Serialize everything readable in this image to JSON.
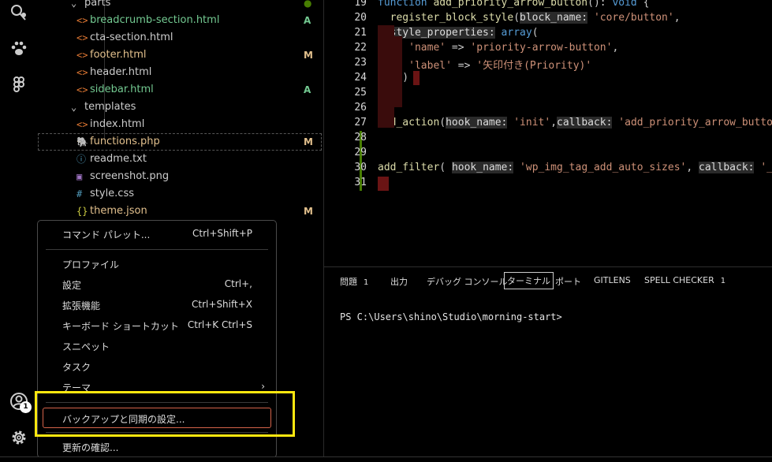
{
  "activity_bar": {
    "icons": [
      "search-fuzzy-icon",
      "paw-icon",
      "figma-icon",
      "account-icon",
      "settings-gear-icon"
    ],
    "account_badge": "1"
  },
  "explorer": {
    "items": [
      {
        "name": "parts",
        "type": "folder",
        "git": "●",
        "color": "#cccccc",
        "git_color": "#487e02"
      },
      {
        "name": "breadcrumb-section.html",
        "type": "html",
        "git": "A",
        "color": "#73c991",
        "git_color": "#73c991"
      },
      {
        "name": "cta-section.html",
        "type": "html",
        "git": "",
        "color": "#cccccc"
      },
      {
        "name": "footer.html",
        "type": "html",
        "git": "M",
        "color": "#e2c08d",
        "git_color": "#e2c08d"
      },
      {
        "name": "header.html",
        "type": "html",
        "git": "",
        "color": "#cccccc"
      },
      {
        "name": "sidebar.html",
        "type": "html",
        "git": "A",
        "color": "#73c991",
        "git_color": "#73c991"
      },
      {
        "name": "templates",
        "type": "folder",
        "git": "",
        "color": "#cccccc"
      },
      {
        "name": "index.html",
        "type": "html",
        "git": "",
        "color": "#cccccc"
      },
      {
        "name": "functions.php",
        "type": "php",
        "git": "M",
        "color": "#e2c08d",
        "git_color": "#e2c08d"
      },
      {
        "name": "readme.txt",
        "type": "info",
        "git": "",
        "color": "#cccccc"
      },
      {
        "name": "screenshot.png",
        "type": "image",
        "git": "",
        "color": "#cccccc"
      },
      {
        "name": "style.css",
        "type": "css",
        "git": "",
        "color": "#cccccc"
      },
      {
        "name": "theme.json",
        "type": "json",
        "git": "M",
        "color": "#e2c08d",
        "git_color": "#e2c08d"
      }
    ]
  },
  "editor": {
    "lines": [
      {
        "n": "19",
        "html": "<span class='kw'>function</span> <span class='fn'>add_priority_arrow_button</span>(): <span class='kw'>void</span> {"
      },
      {
        "n": "20",
        "html": "  <span class='fn'>register_block_style</span>(<span class='hint'>block_name:</span> <span class='str'>'core/button'</span>,"
      },
      {
        "n": "21",
        "html": "  <span class='hint'>style_properties:</span> <span class='kw'>array</span>("
      },
      {
        "n": "22",
        "html": "     <span class='str'>'name'</span> => <span class='str'>'priority-arrow-button'</span>,"
      },
      {
        "n": "23",
        "html": "     <span class='str'>'label'</span> => <span class='str'>'矢印付き(Priority)'</span>"
      },
      {
        "n": "24",
        "html": "    )"
      },
      {
        "n": "25",
        "html": "  );"
      },
      {
        "n": "26",
        "html": " }"
      },
      {
        "n": "27",
        "html": "<span class='fn'>add_action</span>(<span class='hint'>hook_name:</span> <span class='str'>'init'</span>,<span class='hint'>callback:</span> <span class='str'>'add_priority_arrow_button</span>"
      },
      {
        "n": "28",
        "html": ""
      },
      {
        "n": "29",
        "html": ""
      },
      {
        "n": "30",
        "html": "<span class='fn'>add_filter</span>( <span class='hint'>hook_name:</span> <span class='str'>'wp_img_tag_add_auto_sizes'</span>, <span class='hint'>callback:</span> <span class='str'>'__</span>"
      },
      {
        "n": "31",
        "html": ""
      }
    ]
  },
  "panel": {
    "tabs": [
      {
        "label": "問題",
        "count": "1"
      },
      {
        "label": "出力",
        "count": ""
      },
      {
        "label": "デバッグ コンソール",
        "count": ""
      },
      {
        "label": "ターミナル",
        "count": "",
        "active": true
      },
      {
        "label": "ポート",
        "count": ""
      },
      {
        "label": "GITLENS",
        "count": ""
      },
      {
        "label": "SPELL CHECKER",
        "count": "1"
      }
    ],
    "terminal_prompt": "PS C:\\Users\\shino\\Studio\\morning-start>"
  },
  "menu": {
    "items": [
      {
        "label": "コマンド パレット...",
        "shortcut": "Ctrl+Shift+P"
      },
      {
        "sep": true
      },
      {
        "label": "プロファイル",
        "shortcut": ""
      },
      {
        "label": "設定",
        "shortcut": "Ctrl+,"
      },
      {
        "label": "拡張機能",
        "shortcut": "Ctrl+Shift+X"
      },
      {
        "label": "キーボード ショートカット",
        "shortcut": "Ctrl+K Ctrl+S"
      },
      {
        "label": "スニペット",
        "shortcut": ""
      },
      {
        "label": "タスク",
        "shortcut": ""
      },
      {
        "label": "テーマ",
        "shortcut": "",
        "submenu": true
      },
      {
        "sep": true
      },
      {
        "label": "バックアップと同期の設定...",
        "shortcut": "",
        "focused": true
      },
      {
        "sep": true
      },
      {
        "label": "更新の確認...",
        "shortcut": ""
      }
    ]
  }
}
